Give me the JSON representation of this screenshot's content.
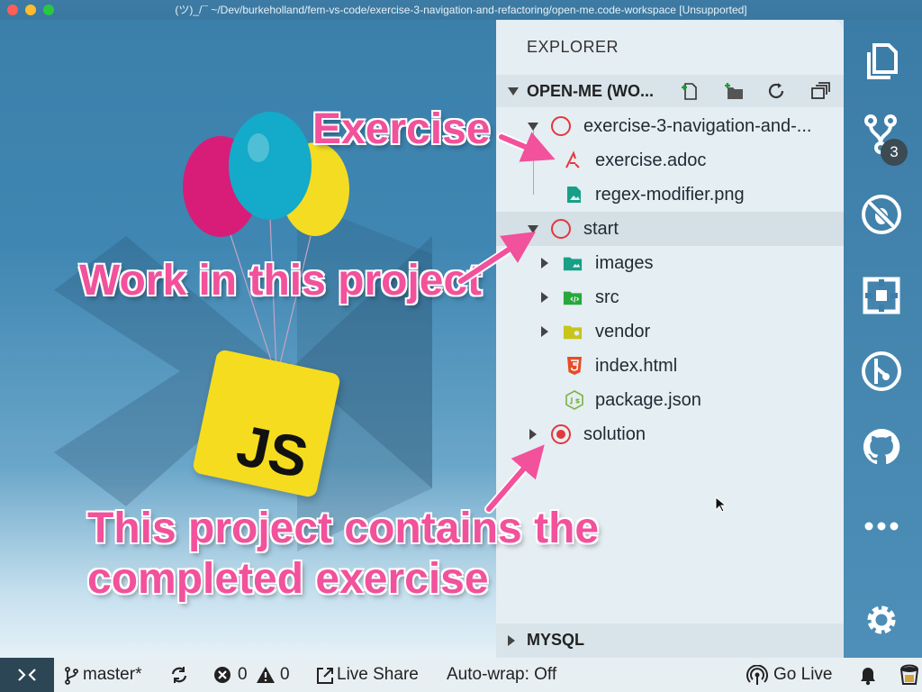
{
  "window": {
    "title": "(ツ)_/¯ ~/Dev/burkeholland/fem-vs-code/exercise-3-navigation-and-refactoring/open-me.code-workspace [Unsupported]",
    "traffic_colors": [
      "#fe5f57",
      "#febc2e",
      "#28c840"
    ]
  },
  "editor": {
    "logo_text": "JS"
  },
  "explorer": {
    "title": "EXPLORER",
    "workspace_label": "OPEN-ME (WO...",
    "toolbar_icons": [
      "new-file-icon",
      "new-folder-icon",
      "refresh-icon",
      "collapse-all-icon"
    ],
    "tree": [
      {
        "label": "exercise-3-navigation-and-...",
        "kind": "root-folder",
        "expanded": true
      },
      {
        "label": "exercise.adoc",
        "kind": "file",
        "icon": "asciidoc-icon"
      },
      {
        "label": "regex-modifier.png",
        "kind": "file",
        "icon": "image-file-icon"
      },
      {
        "label": "start",
        "kind": "root-folder",
        "expanded": true,
        "highlighted": true
      },
      {
        "label": "images",
        "kind": "folder",
        "icon": "images-folder-icon"
      },
      {
        "label": "src",
        "kind": "folder",
        "icon": "src-folder-icon"
      },
      {
        "label": "vendor",
        "kind": "folder",
        "icon": "vendor-folder-icon"
      },
      {
        "label": "index.html",
        "kind": "file",
        "icon": "html5-icon"
      },
      {
        "label": "package.json",
        "kind": "file",
        "icon": "nodejs-icon"
      },
      {
        "label": "solution",
        "kind": "root-folder",
        "expanded": false
      }
    ],
    "mysql_label": "MYSQL"
  },
  "activity_bar": {
    "items": [
      "explorer-icon",
      "source-control-icon",
      "no-debug-icon",
      "extensions-icon",
      "gitlens-icon",
      "github-icon",
      "more-icon",
      "settings-icon"
    ],
    "source_control_badge": "3"
  },
  "annotations": {
    "exercise": "Exercise",
    "work": "Work in this project",
    "solution_line1": "This project contains the",
    "solution_line2": "completed exercise",
    "color": "#f2519b"
  },
  "status_bar": {
    "branch": "master*",
    "errors": "0",
    "warnings": "0",
    "live_share": "Live Share",
    "auto_wrap": "Auto-wrap: Off",
    "go_live": "Go Live"
  }
}
